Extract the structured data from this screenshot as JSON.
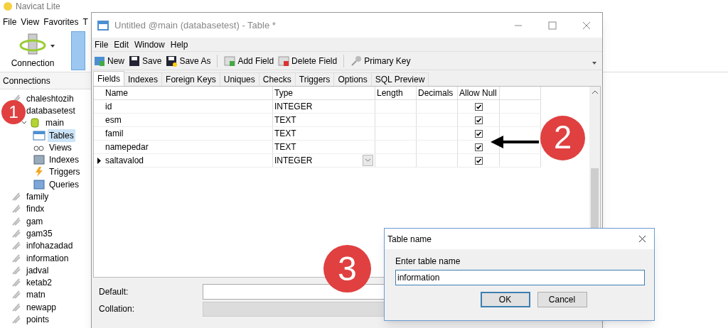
{
  "app": {
    "title": "Navicat Lite",
    "menu": [
      "File",
      "View",
      "Favorites",
      "T"
    ],
    "toolbar": [
      {
        "label": "Connection"
      }
    ],
    "connections_header": "Connections",
    "tree": [
      {
        "label": "chaleshtozih",
        "kind": "connection",
        "selected": false
      },
      {
        "label": "databasetest",
        "kind": "connection",
        "selected": false,
        "children": [
          {
            "label": "main",
            "kind": "database",
            "expanded": true,
            "selected": false,
            "children": [
              {
                "label": "Tables",
                "kind": "tables",
                "selected": true
              },
              {
                "label": "Views",
                "kind": "views",
                "selected": false
              },
              {
                "label": "Indexes",
                "kind": "indexes",
                "selected": false
              },
              {
                "label": "Triggers",
                "kind": "triggers",
                "selected": false
              },
              {
                "label": "Queries",
                "kind": "queries",
                "selected": false
              }
            ]
          }
        ]
      },
      {
        "label": "family",
        "kind": "connection",
        "selected": false
      },
      {
        "label": "findx",
        "kind": "connection",
        "selected": false
      },
      {
        "label": "gam",
        "kind": "connection",
        "selected": false
      },
      {
        "label": "gam35",
        "kind": "connection",
        "selected": false
      },
      {
        "label": "infohazadad",
        "kind": "connection",
        "selected": false
      },
      {
        "label": "information",
        "kind": "connection",
        "selected": false
      },
      {
        "label": "jadval",
        "kind": "connection",
        "selected": false
      },
      {
        "label": "ketab2",
        "kind": "connection",
        "selected": false
      },
      {
        "label": "matn",
        "kind": "connection",
        "selected": false
      },
      {
        "label": "newapp",
        "kind": "connection",
        "selected": false
      },
      {
        "label": "points",
        "kind": "connection",
        "selected": false
      }
    ]
  },
  "table_window": {
    "title": "Untitled @main (databasetest) - Table *",
    "menu": [
      "File",
      "Edit",
      "Window",
      "Help"
    ],
    "toolbar": [
      {
        "label": "New",
        "kind": "new"
      },
      {
        "label": "Save",
        "kind": "save"
      },
      {
        "label": "Save As",
        "kind": "saveas"
      },
      {
        "label": "Add Field",
        "kind": "add"
      },
      {
        "label": "Delete Field",
        "kind": "delete"
      },
      {
        "label": "Primary Key",
        "kind": "key"
      }
    ],
    "tabs": [
      {
        "label": "Fields",
        "selected": true
      },
      {
        "label": "Indexes",
        "selected": false
      },
      {
        "label": "Foreign Keys",
        "selected": false
      },
      {
        "label": "Uniques",
        "selected": false
      },
      {
        "label": "Checks",
        "selected": false
      },
      {
        "label": "Triggers",
        "selected": false
      },
      {
        "label": "Options",
        "selected": false
      },
      {
        "label": "SQL Preview",
        "selected": false
      }
    ],
    "columns": [
      "Name",
      "Type",
      "Length",
      "Decimals",
      "Allow Null"
    ],
    "rows": [
      {
        "name": "id",
        "type": "INTEGER",
        "allow_null": true,
        "current": false
      },
      {
        "name": "esm",
        "type": "TEXT",
        "allow_null": true,
        "current": false
      },
      {
        "name": "famil",
        "type": "TEXT",
        "allow_null": true,
        "current": false
      },
      {
        "name": "namepedar",
        "type": "TEXT",
        "allow_null": true,
        "current": false
      },
      {
        "name": "saltavalod",
        "type": "INTEGER",
        "allow_null": true,
        "current": true
      }
    ],
    "default_label": "Default:",
    "collation_label": "Collation:"
  },
  "dialog": {
    "title": "Table name",
    "prompt": "Enter table name",
    "value": "information",
    "buttons": [
      "OK",
      "Cancel"
    ]
  },
  "annotations": [
    {
      "label": "1"
    },
    {
      "label": "2"
    },
    {
      "label": "3"
    }
  ]
}
